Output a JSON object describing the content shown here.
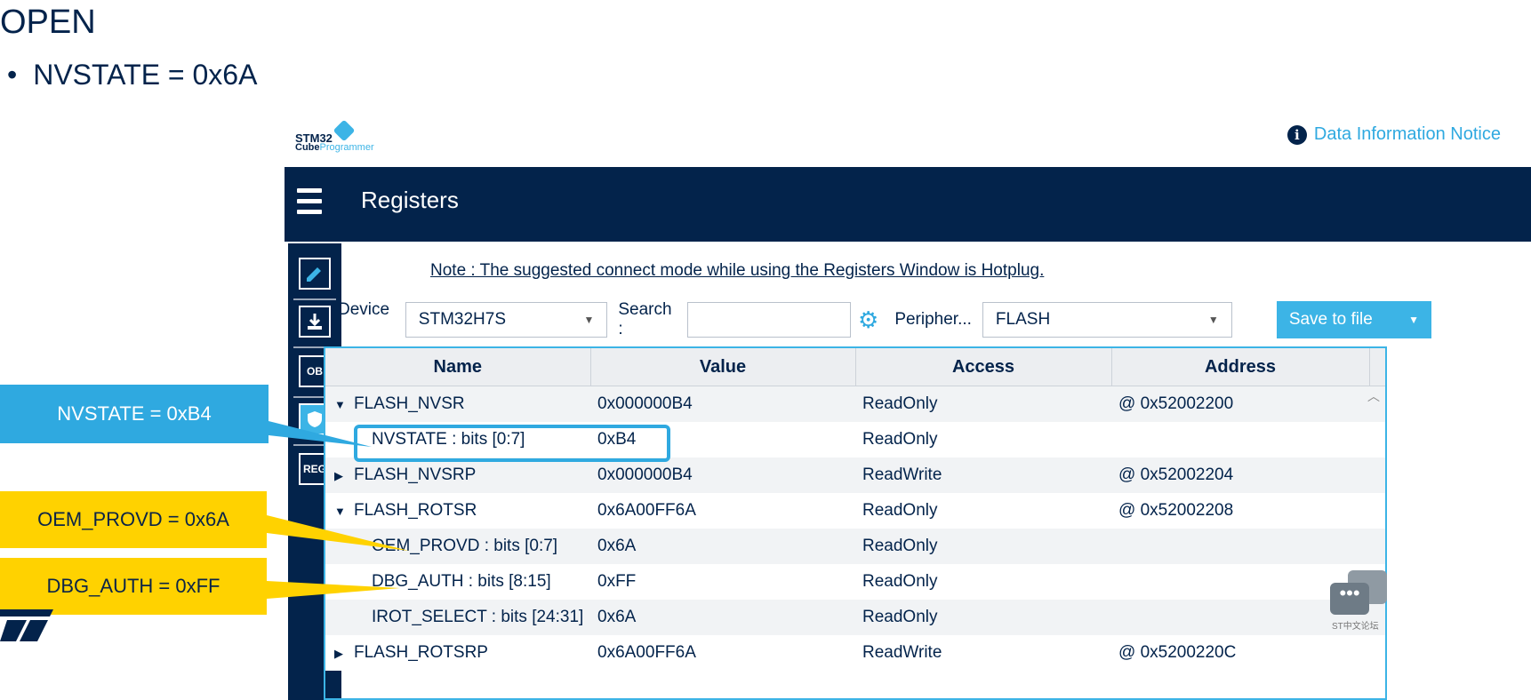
{
  "slide": {
    "title": "OPEN",
    "bullet": "NVSTATE = 0x6A"
  },
  "callouts": {
    "nvstate": "NVSTATE = 0xB4",
    "oem_provd": "OEM_PROVD = 0x6A",
    "dbg_auth": "DBG_AUTH = 0xFF"
  },
  "app": {
    "logo_top": "STM32",
    "logo_cube": "Cube",
    "logo_programmer": "Programmer",
    "notice": "Data Information Notice",
    "title": "Registers",
    "note": "Note : The suggested connect mode while using the Registers Window is Hotplug.",
    "device_label": "Device :",
    "device_value": "STM32H7S",
    "search_label": "Search :",
    "search_value": "",
    "peripheral_label": "Peripher...",
    "peripheral_value": "FLASH",
    "save_label": "Save to file",
    "sidebar": [
      "edit-icon",
      "download-icon",
      "OB",
      "shield-icon",
      "REG"
    ],
    "columns": [
      "Name",
      "Value",
      "Access",
      "Address"
    ],
    "rows": [
      {
        "name": "FLASH_NVSR",
        "value": "0x000000B4",
        "access": "ReadOnly",
        "address": "@ 0x52002200",
        "expand": "▼"
      },
      {
        "name": "NVSTATE : bits [0:7]",
        "value": "0xB4",
        "access": "ReadOnly",
        "address": "",
        "expand": ""
      },
      {
        "name": "FLASH_NVSRP",
        "value": "0x000000B4",
        "access": "ReadWrite",
        "address": "@ 0x52002204",
        "expand": "▶"
      },
      {
        "name": "FLASH_ROTSR",
        "value": "0x6A00FF6A",
        "access": "ReadOnly",
        "address": "@ 0x52002208",
        "expand": "▼"
      },
      {
        "name": "OEM_PROVD : bits [0:7]",
        "value": "0x6A",
        "access": "ReadOnly",
        "address": "",
        "expand": ""
      },
      {
        "name": "DBG_AUTH : bits [8:15]",
        "value": "0xFF",
        "access": "ReadOnly",
        "address": "",
        "expand": ""
      },
      {
        "name": "IROT_SELECT : bits [24:31]",
        "value": "0x6A",
        "access": "ReadOnly",
        "address": "",
        "expand": ""
      },
      {
        "name": "FLASH_ROTSRP",
        "value": "0x6A00FF6A",
        "access": "ReadWrite",
        "address": "@ 0x5200220C",
        "expand": "▶"
      }
    ]
  },
  "watermark": "ST中文论坛"
}
